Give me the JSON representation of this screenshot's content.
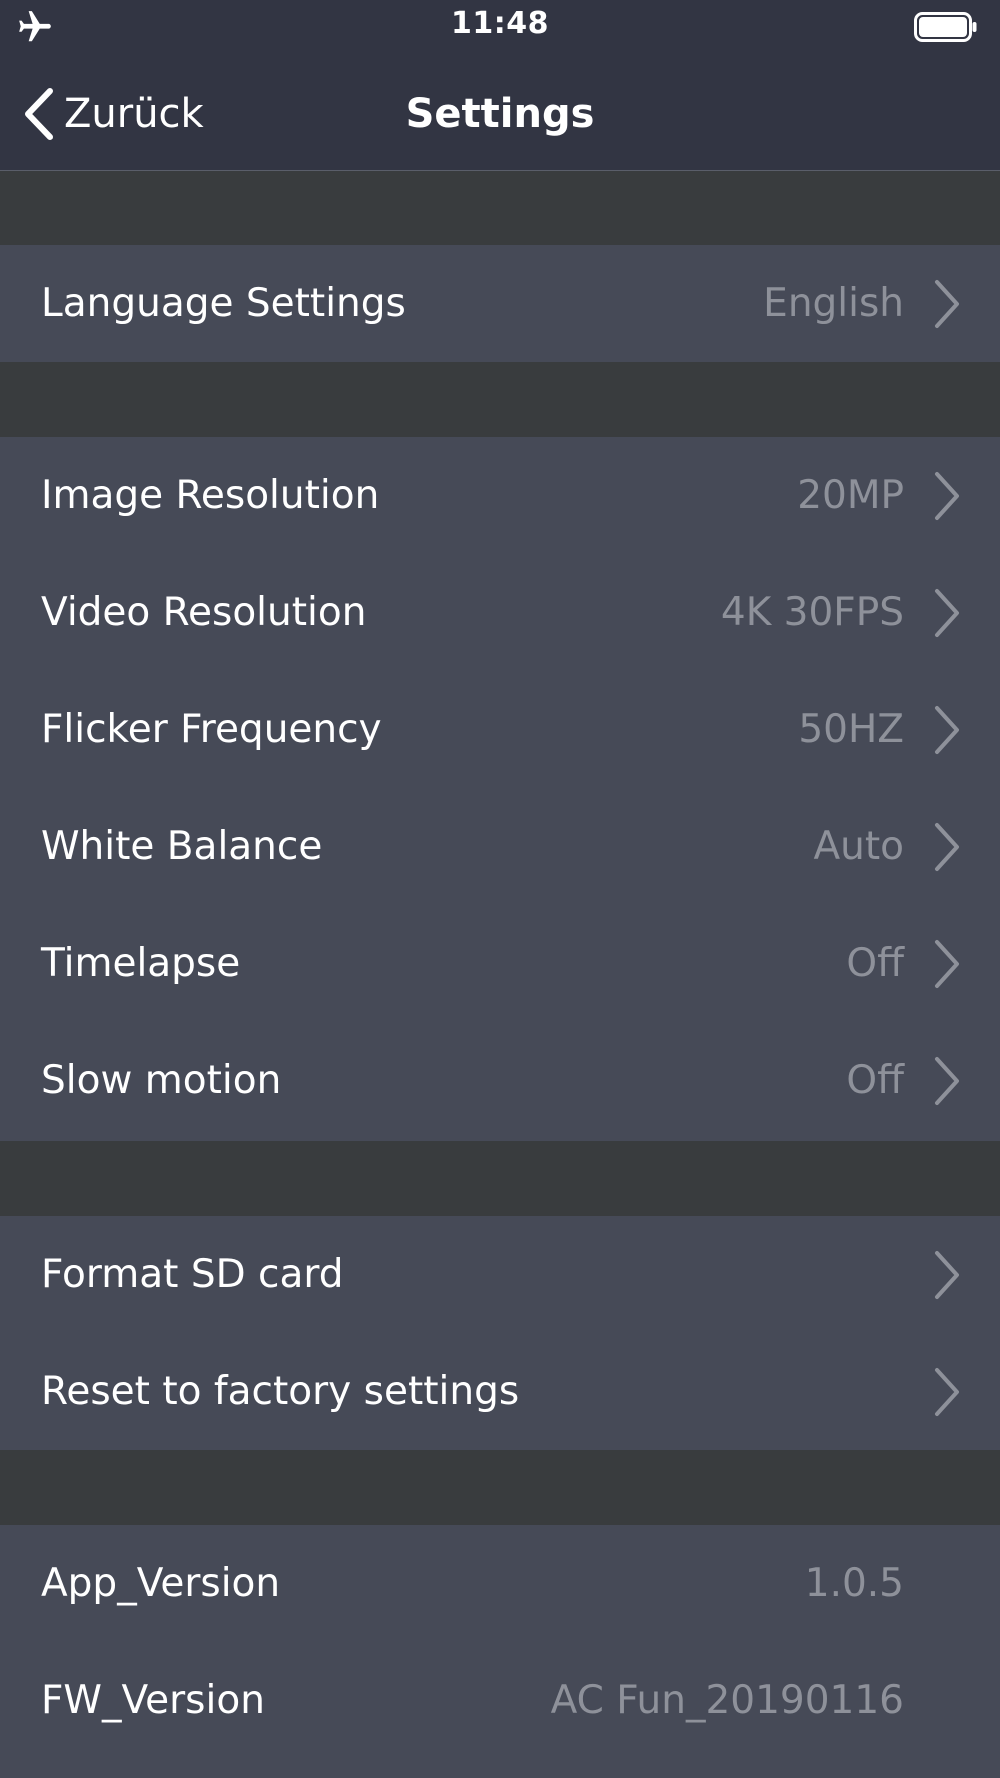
{
  "status_bar": {
    "time": "11:48",
    "airplane_icon": "airplane-icon",
    "battery_icon": "battery-icon",
    "battery_level": 1.0
  },
  "nav": {
    "back_label": "Zurück",
    "title": "Settings"
  },
  "sections": [
    {
      "rows": [
        {
          "label": "Language Settings",
          "value": "English",
          "chevron": true
        }
      ]
    },
    {
      "rows": [
        {
          "label": "Image Resolution",
          "value": "20MP",
          "chevron": true
        },
        {
          "label": "Video Resolution",
          "value": "4K 30FPS",
          "chevron": true
        },
        {
          "label": "Flicker Frequency",
          "value": "50HZ",
          "chevron": true
        },
        {
          "label": "White Balance",
          "value": "Auto",
          "chevron": true
        },
        {
          "label": "Timelapse",
          "value": "Off",
          "chevron": true
        },
        {
          "label": "Slow motion",
          "value": "Off",
          "chevron": true
        }
      ]
    },
    {
      "rows": [
        {
          "label": "Format SD card",
          "value": "",
          "chevron": true
        },
        {
          "label": "Reset to factory settings",
          "value": "",
          "chevron": true
        }
      ]
    },
    {
      "rows": [
        {
          "label": "App_Version",
          "value": "1.0.5",
          "chevron": false
        },
        {
          "label": "FW_Version",
          "value": "AC Fun_20190116",
          "chevron": false
        }
      ]
    }
  ],
  "colors": {
    "bar_background": "#323543",
    "row_background": "#464a57",
    "spacer_background": "#393c3e",
    "label_text": "#ffffff",
    "value_text": "#8e919a",
    "chevron": "#8e919a"
  }
}
